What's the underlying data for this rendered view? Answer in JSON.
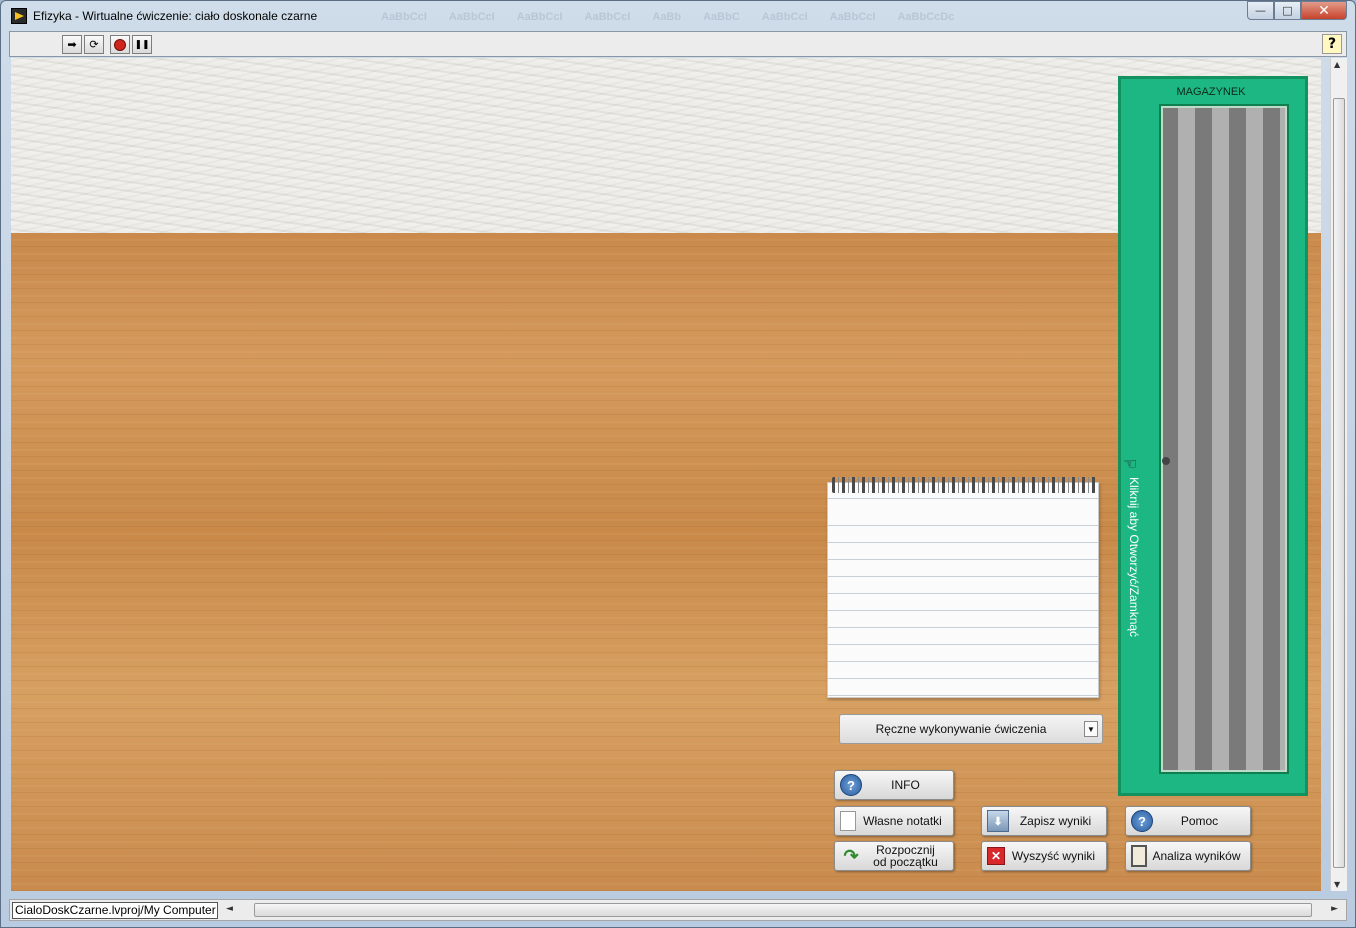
{
  "window": {
    "title": "Efizyka - Wirtualne ćwiczenie: ciało doskonale czarne",
    "ghost_styles": [
      "AaBbCcI",
      "AaBbCcI",
      "AaBbCcI",
      "AaBbCcI",
      "AaBb",
      "AaBbC",
      "AaBbCcI",
      "AaBbCcI",
      "AaBbCcDc"
    ],
    "min_icon": "minimize-icon",
    "max_icon": "maximize-icon",
    "close_icon": "close-icon",
    "max_glyph": "□",
    "close_glyph": "✕"
  },
  "toolbar": {
    "run_icon": "run-arrow-icon",
    "run_cont_icon": "run-continuously-icon",
    "abort_icon": "abort-icon",
    "pause_icon": "pause-icon",
    "help_label": "?",
    "run_glyph": "➡",
    "run_cont_glyph": "⟳",
    "pause_glyph": "❚❚"
  },
  "storage": {
    "title": "MAGAZYNEK",
    "hint": "Kliknij aby Otworzyć/Zamknąć",
    "hand_glyph": "☜",
    "color": "#1db784"
  },
  "mode_select": {
    "value": "Ręczne wykonywanie ćwiczenia",
    "arrow_glyph": "▼"
  },
  "buttons": {
    "info": {
      "label": "INFO",
      "icon": "info-icon",
      "glyph": "?"
    },
    "notes": {
      "label": "Własne notatki",
      "icon": "notes-icon"
    },
    "restart": {
      "label": "Rozpocznij\nod początku",
      "icon": "restart-arrow-icon",
      "glyph": "↷"
    },
    "save": {
      "label": "Zapisz wyniki",
      "icon": "save-tray-icon",
      "glyph": "⬇"
    },
    "clear": {
      "label": "Wyszyść wyniki",
      "icon": "red-x-icon",
      "glyph": "✕"
    },
    "help": {
      "label": "Pomoc",
      "icon": "help-icon",
      "glyph": "?"
    },
    "analyze": {
      "label": "Analiza wyników",
      "icon": "clipboard-icon"
    }
  },
  "status": {
    "path": "CialoDoskCzarne.lvproj/My Computer",
    "left_arrow": "◄",
    "right_arrow": "►",
    "up_arrow": "▲",
    "down_arrow": "▼"
  }
}
